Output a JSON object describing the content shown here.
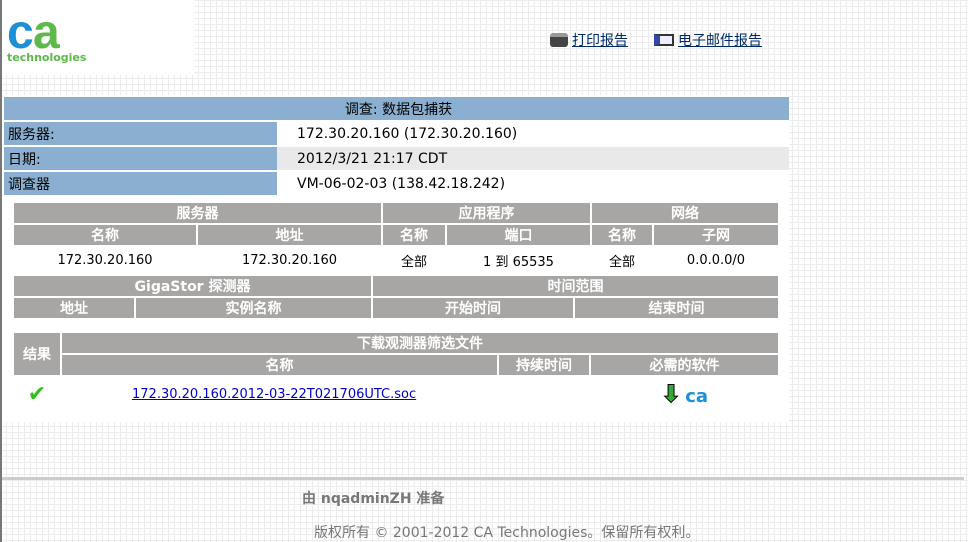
{
  "logo": {
    "text": "ca",
    "sub": "technologies"
  },
  "links": {
    "print": "打印报告",
    "email": "电子邮件报告"
  },
  "investigation": {
    "title": "调查: 数据包捕获",
    "rows": [
      {
        "label": "服务器:",
        "value": "172.30.20.160 (172.30.20.160)"
      },
      {
        "label": "日期:",
        "value": "2012/3/21 21:17 CDT"
      },
      {
        "label": "调查器",
        "value": "VM-06-02-03 (138.42.18.242)"
      }
    ]
  },
  "filter": {
    "server": "服务器",
    "application": "应用程序",
    "network": "网络",
    "name": "名称",
    "address": "地址",
    "port": "端口",
    "subnet": "子网",
    "row": {
      "server_name": "172.30.20.160",
      "server_address": "172.30.20.160",
      "app_name": "全部",
      "port": "1 到  65535",
      "net_name": "全部",
      "subnet": "0.0.0.0/0"
    }
  },
  "probe": {
    "gigastor": "GigaStor 探测器",
    "time_range": "时间范围",
    "address": "地址",
    "instance": "实例名称",
    "start": "开始时间",
    "end": "结束时间"
  },
  "results": {
    "result": "结果",
    "download": "下载观测器筛选文件",
    "name": "名称",
    "duration": "持续时间",
    "software": "必需的软件",
    "file": "172.30.20.160.2012-03-22T021706UTC.soc"
  },
  "footer": {
    "prepared": "由  nqadminZH 准备",
    "copyright": "版权所有 © 2001-2012 CA Technologies。保留所有权利。"
  }
}
